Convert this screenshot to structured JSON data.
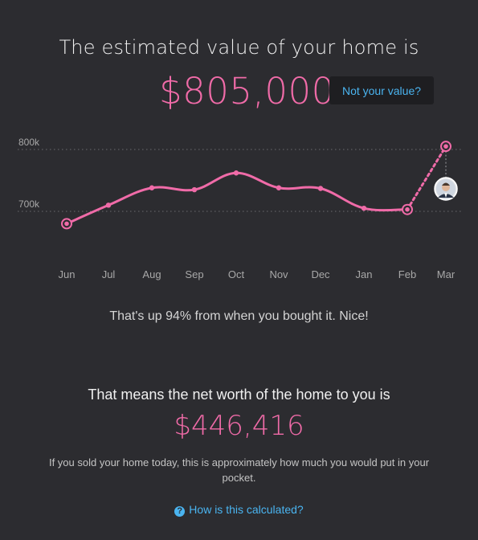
{
  "header": {
    "headline": "The estimated value of your home is",
    "value": "$805,000",
    "not_value_button": "Not your value?"
  },
  "chart_data": {
    "type": "line",
    "categories": [
      "Jun",
      "Jul",
      "Aug",
      "Sep",
      "Oct",
      "Nov",
      "Dec",
      "Jan",
      "Feb",
      "Mar"
    ],
    "series": [
      {
        "values": [
          680,
          710,
          738,
          735,
          762,
          738,
          737,
          705,
          703,
          805
        ]
      }
    ],
    "y_tick_labels": [
      "800k",
      "700k"
    ],
    "y_ticks": [
      800,
      700
    ],
    "ylim": [
      660,
      820
    ],
    "grid": "dotted horizontal at 700k and 800k",
    "marked_points": [
      "Jun",
      "Feb",
      "Mar"
    ],
    "projected_segment": [
      "Feb",
      "Mar"
    ],
    "line_color": "#f06ba8",
    "grid_color": "#6a6a6e"
  },
  "summary": {
    "up_text": "That's up 94% from when you bought it. Nice!"
  },
  "net_worth": {
    "title": "That means the net worth of the home to you is",
    "value": "$446,416",
    "note": "If you sold your home today, this is approximately how much you would put in your pocket."
  },
  "help": {
    "icon": "question-circle-icon",
    "link_text": "How is this calculated?"
  }
}
